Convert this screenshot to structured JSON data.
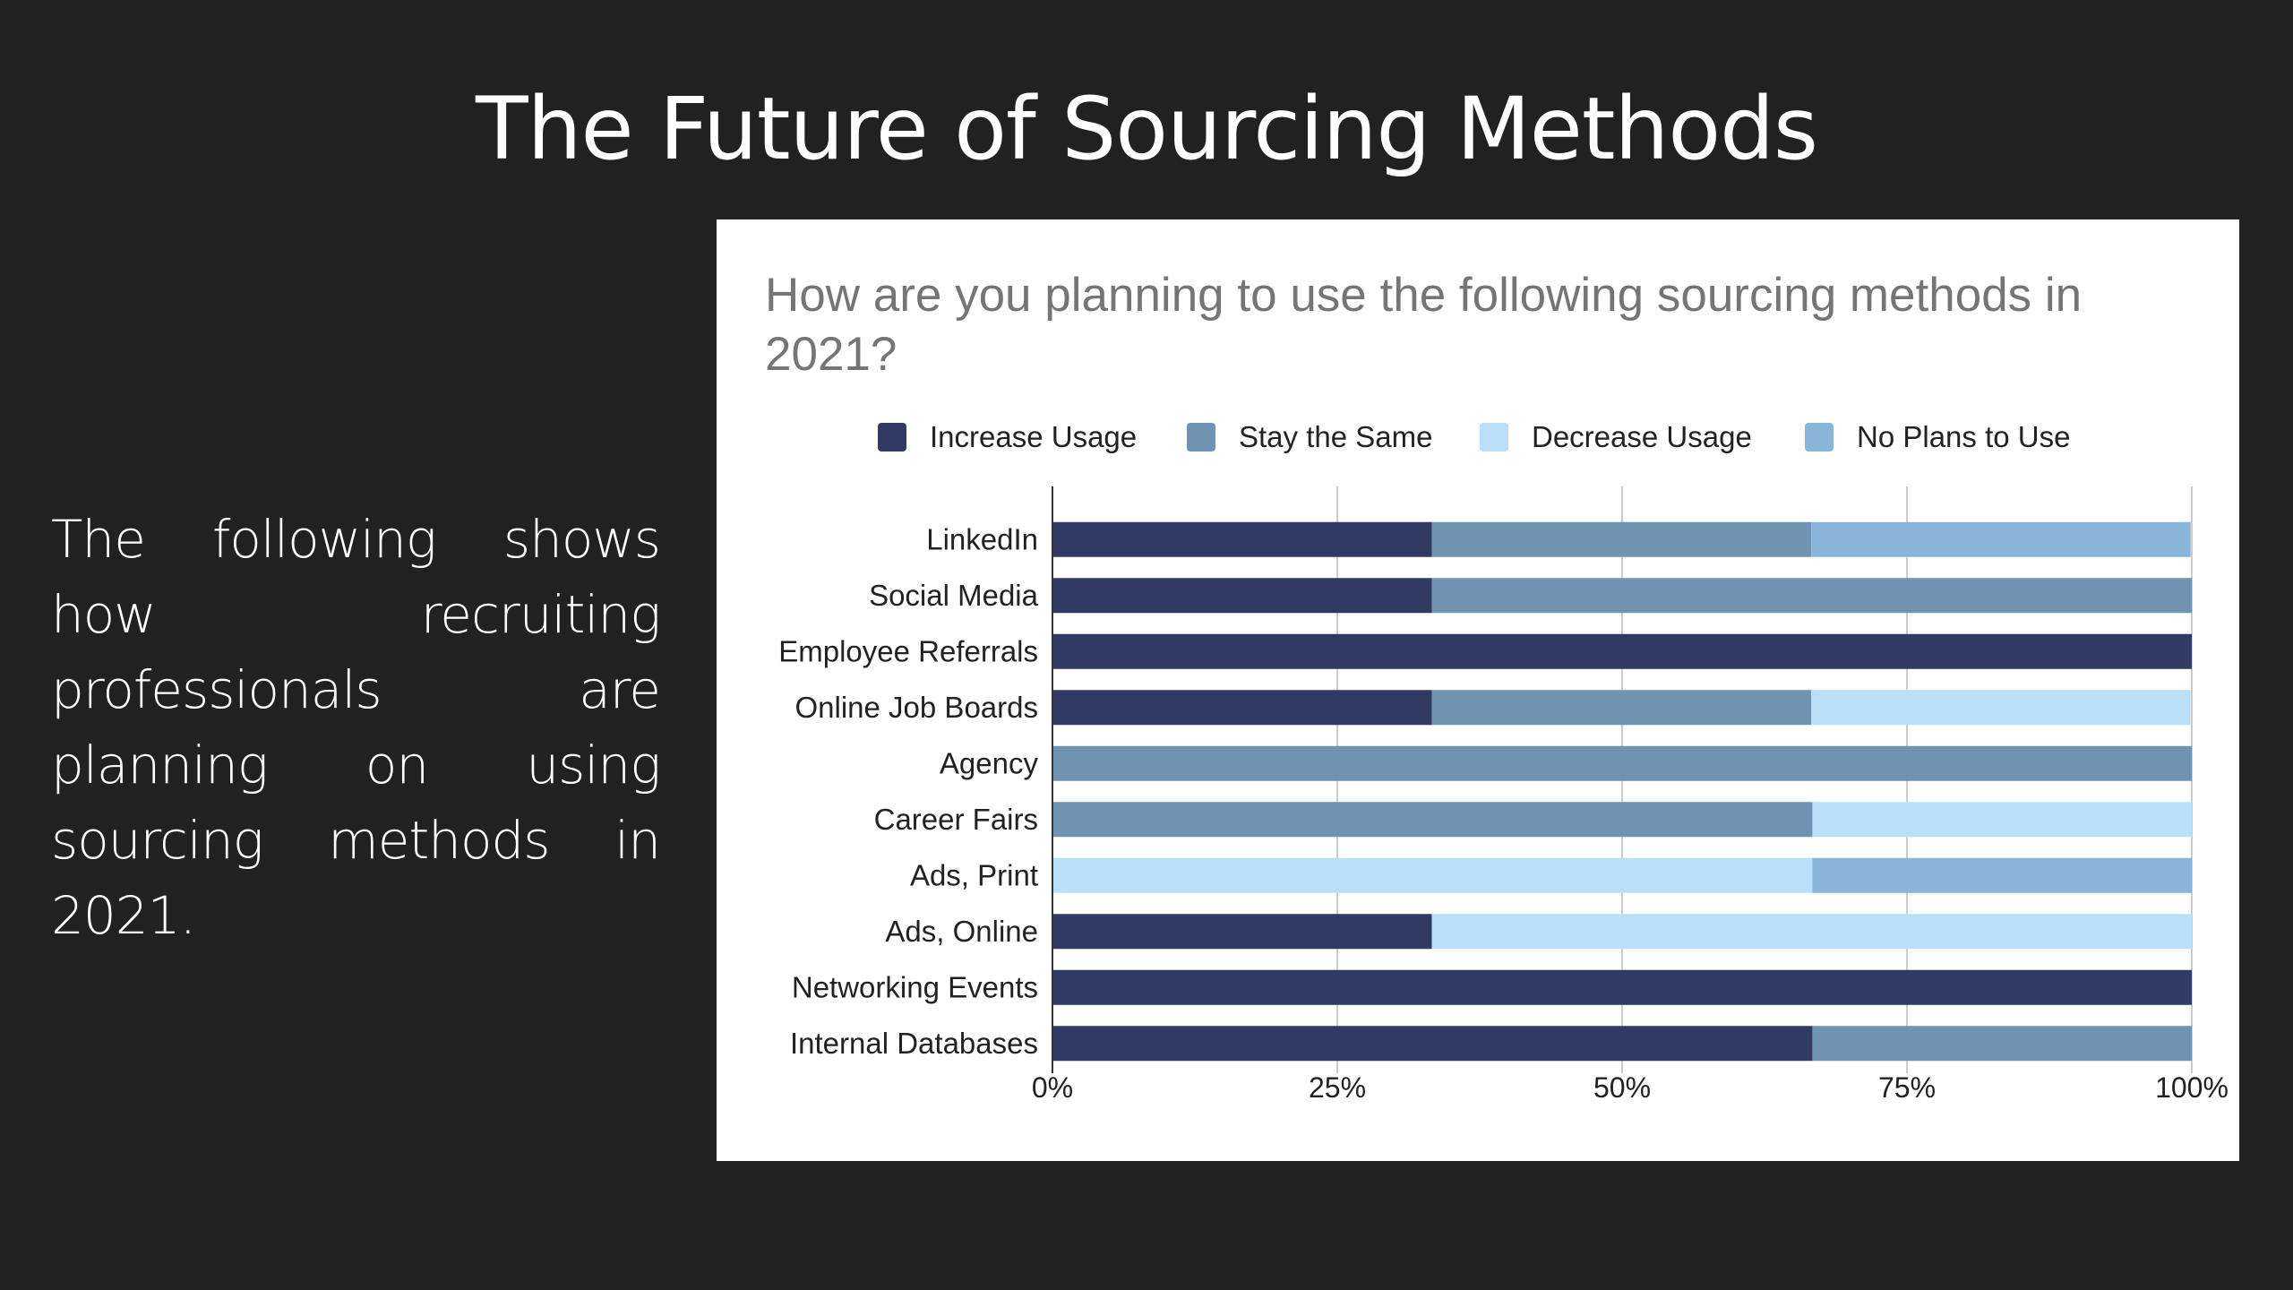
{
  "slide": {
    "title": "The Future of Sourcing Methods",
    "body": "The following shows how recruiting professionals are planning on using sourcing methods in 2021."
  },
  "chart_data": {
    "type": "bar",
    "orientation": "horizontal",
    "stacked": "percent",
    "title": "How are you planning to use the following sourcing methods in 2021?",
    "xlabel": "",
    "ylabel": "",
    "xlim": [
      0,
      100
    ],
    "x_ticks": [
      "0%",
      "25%",
      "50%",
      "75%",
      "100%"
    ],
    "grid": true,
    "legend_position": "top",
    "categories": [
      "LinkedIn",
      "Social Media",
      "Employee Referrals",
      "Online Job Boards",
      "Agency",
      "Career Fairs",
      "Ads, Print",
      "Ads, Online",
      "Networking Events",
      "Internal Databases"
    ],
    "series": [
      {
        "name": "Increase Usage",
        "color": "#303a63",
        "values": [
          33.3,
          33.3,
          100,
          33.3,
          0,
          0,
          0,
          33.3,
          100,
          66.7
        ]
      },
      {
        "name": "Stay the Same",
        "color": "#6f93b1",
        "values": [
          33.3,
          66.7,
          0,
          33.3,
          100,
          66.7,
          0,
          0,
          0,
          33.3
        ]
      },
      {
        "name": "Decrease Usage",
        "color": "#b9dff9",
        "values": [
          0,
          0,
          0,
          33.3,
          0,
          33.3,
          66.7,
          66.7,
          0,
          0
        ]
      },
      {
        "name": "No Plans to Use",
        "color": "#89b5d9",
        "values": [
          33.3,
          0,
          0,
          0,
          0,
          0,
          33.3,
          0,
          0,
          0
        ]
      }
    ]
  }
}
